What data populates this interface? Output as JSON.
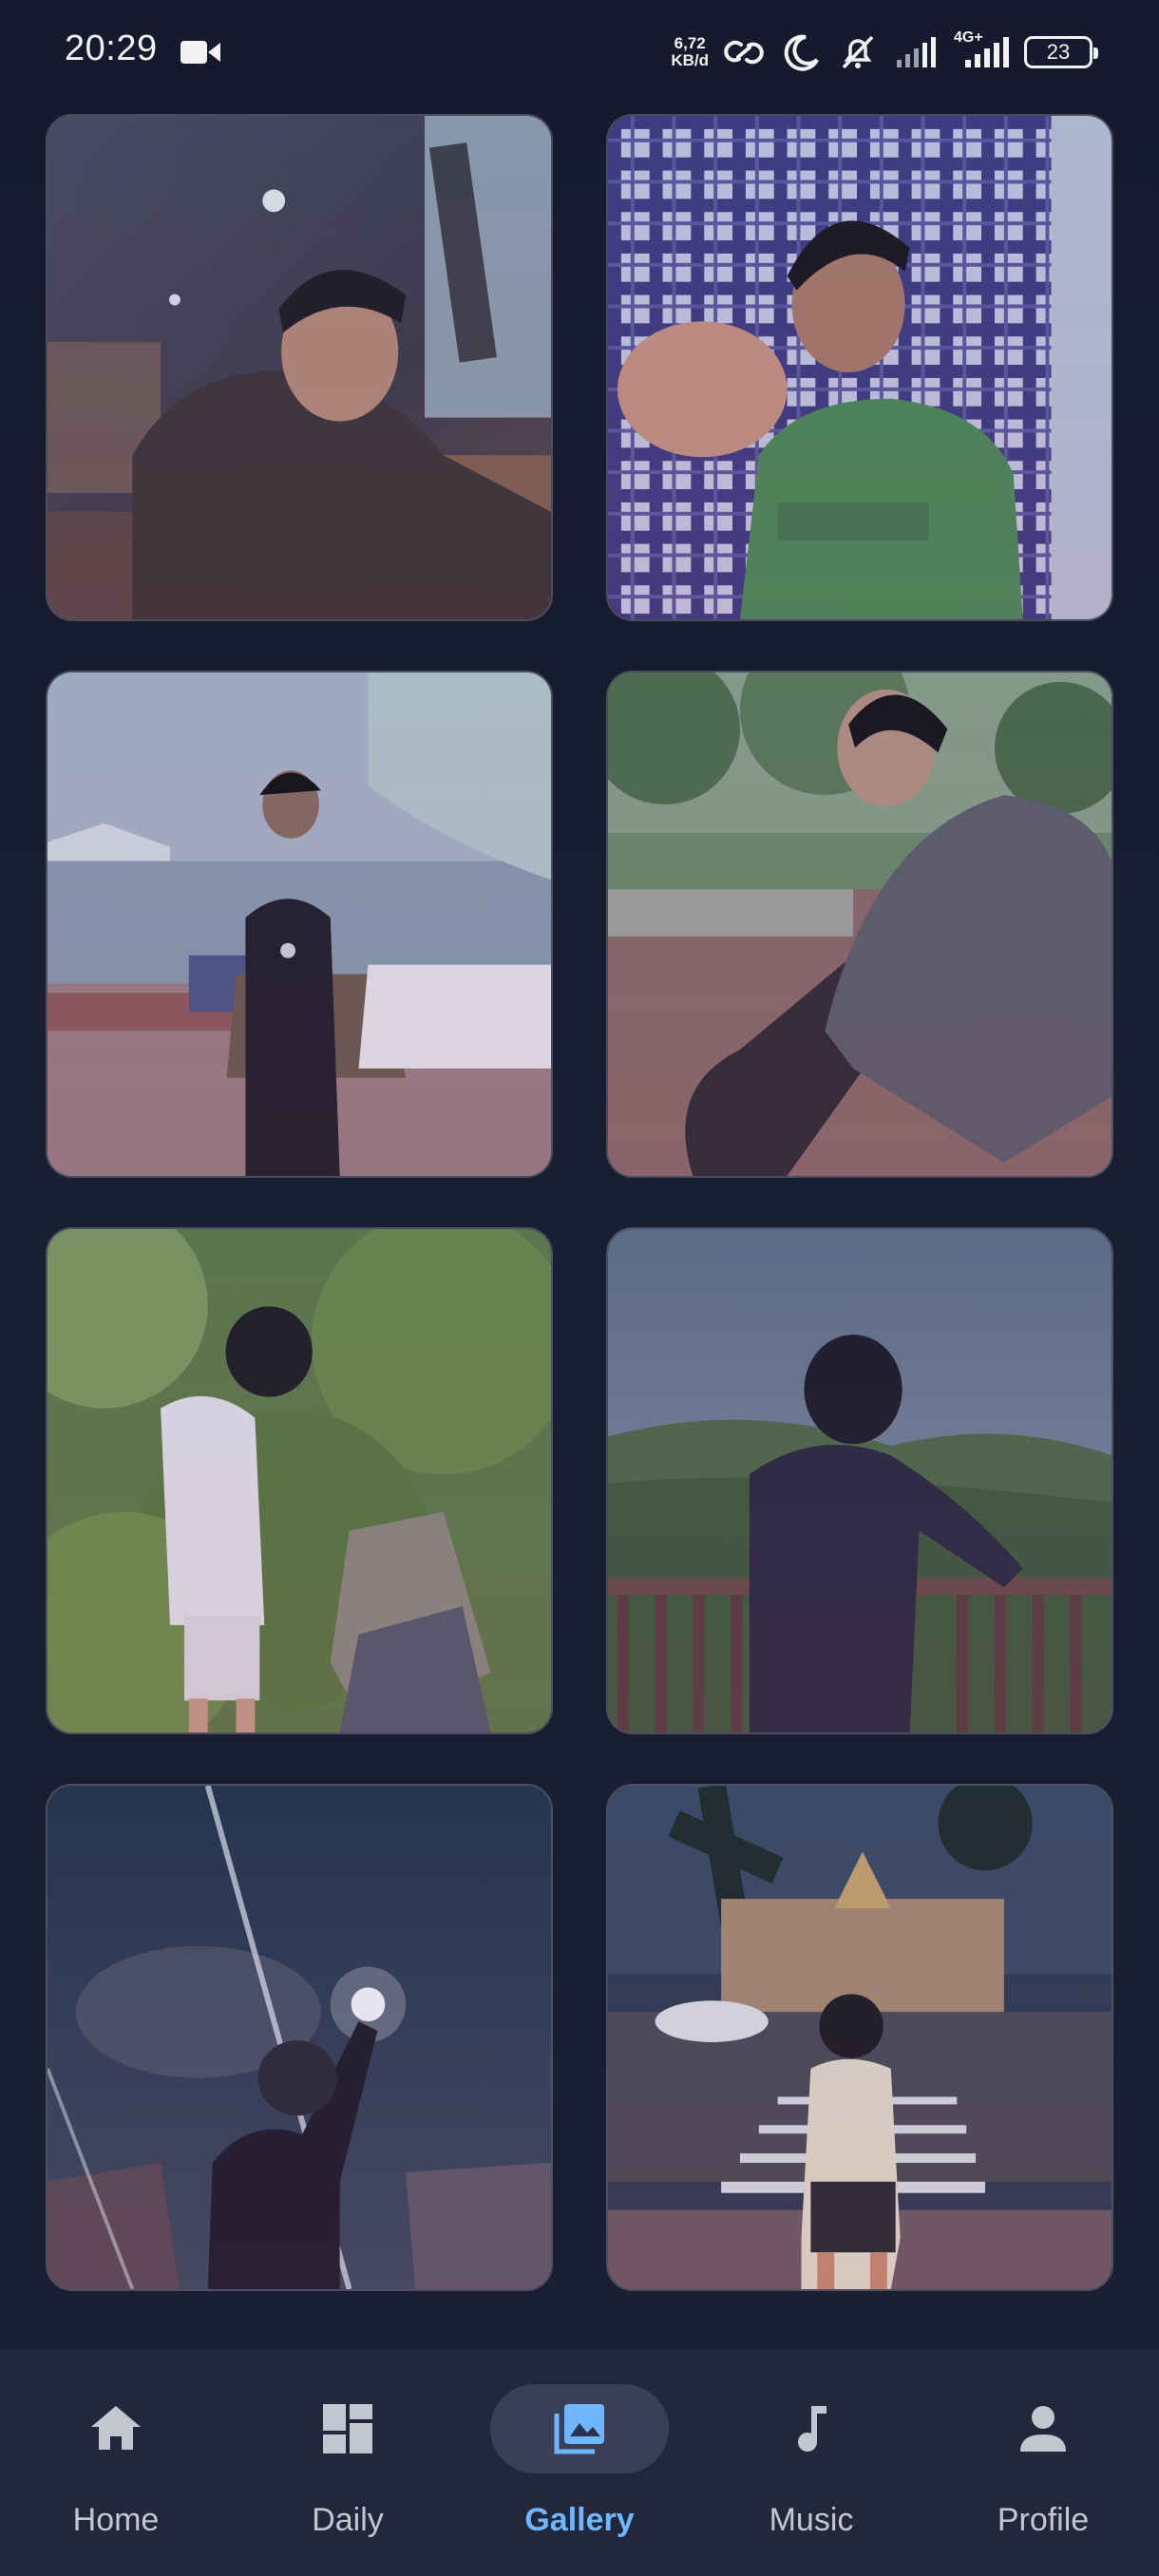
{
  "status_bar": {
    "time": "20:29",
    "speed_value": "6,72",
    "speed_unit": "KB/d",
    "network": "4G+",
    "battery": "23",
    "icons": [
      "video-record-icon",
      "link-icon",
      "moon-icon",
      "silent-icon",
      "signal-icon",
      "signal-4g-icon",
      "battery-icon"
    ]
  },
  "gallery": {
    "photos": [
      {
        "name": "photo-1"
      },
      {
        "name": "photo-2"
      },
      {
        "name": "photo-3"
      },
      {
        "name": "photo-4"
      },
      {
        "name": "photo-5"
      },
      {
        "name": "photo-6"
      },
      {
        "name": "photo-7"
      },
      {
        "name": "photo-8"
      }
    ]
  },
  "nav": {
    "items": [
      {
        "label": "Home",
        "icon": "home-icon"
      },
      {
        "label": "Daily",
        "icon": "dashboard-icon"
      },
      {
        "label": "Gallery",
        "icon": "image-icon",
        "active": true
      },
      {
        "label": "Music",
        "icon": "music-note-icon"
      },
      {
        "label": "Profile",
        "icon": "person-icon"
      }
    ],
    "active_color": "#6fb6ff",
    "inactive_color": "#c4c7d2"
  }
}
